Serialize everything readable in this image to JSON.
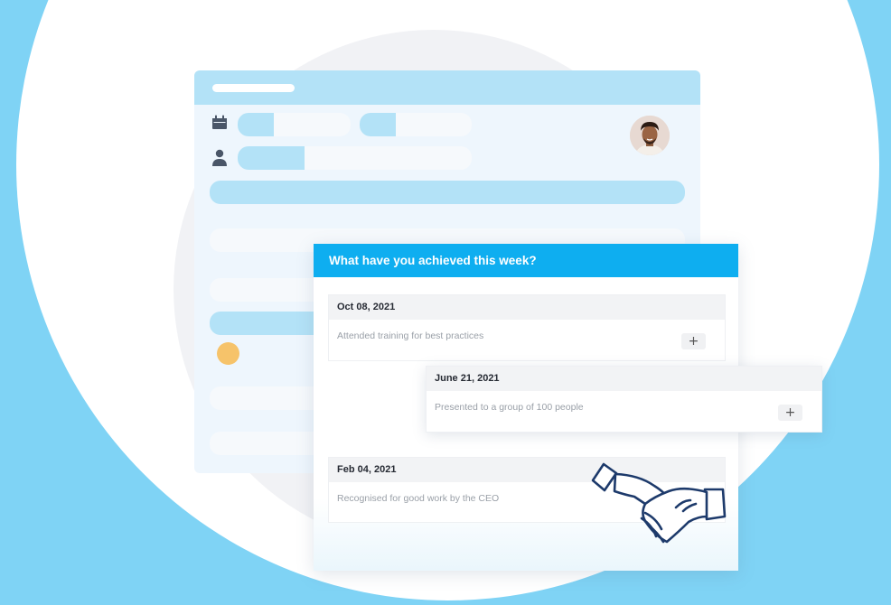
{
  "colors": {
    "page_background": "#7fd3f5",
    "accent": "#0eaef0",
    "placeholder_blue": "#b3e2f7",
    "orange_dot": "#f6c36a",
    "handshake_stroke": "#1d3a6b"
  },
  "icons": {
    "calendar": "calendar-icon",
    "user": "user-icon",
    "add": "plus-icon",
    "illustration": "handshake-icon"
  },
  "panel": {
    "title": "What have you achieved this week?"
  },
  "entries": [
    {
      "date": "Oct 08, 2021",
      "description": "Attended training for best practices",
      "button": "+"
    },
    {
      "date": "June 21, 2021",
      "description": "Presented to a group of 100 people",
      "button": "+"
    },
    {
      "date": "Feb 04, 2021",
      "description": "Recognised for good work by the CEO"
    }
  ]
}
